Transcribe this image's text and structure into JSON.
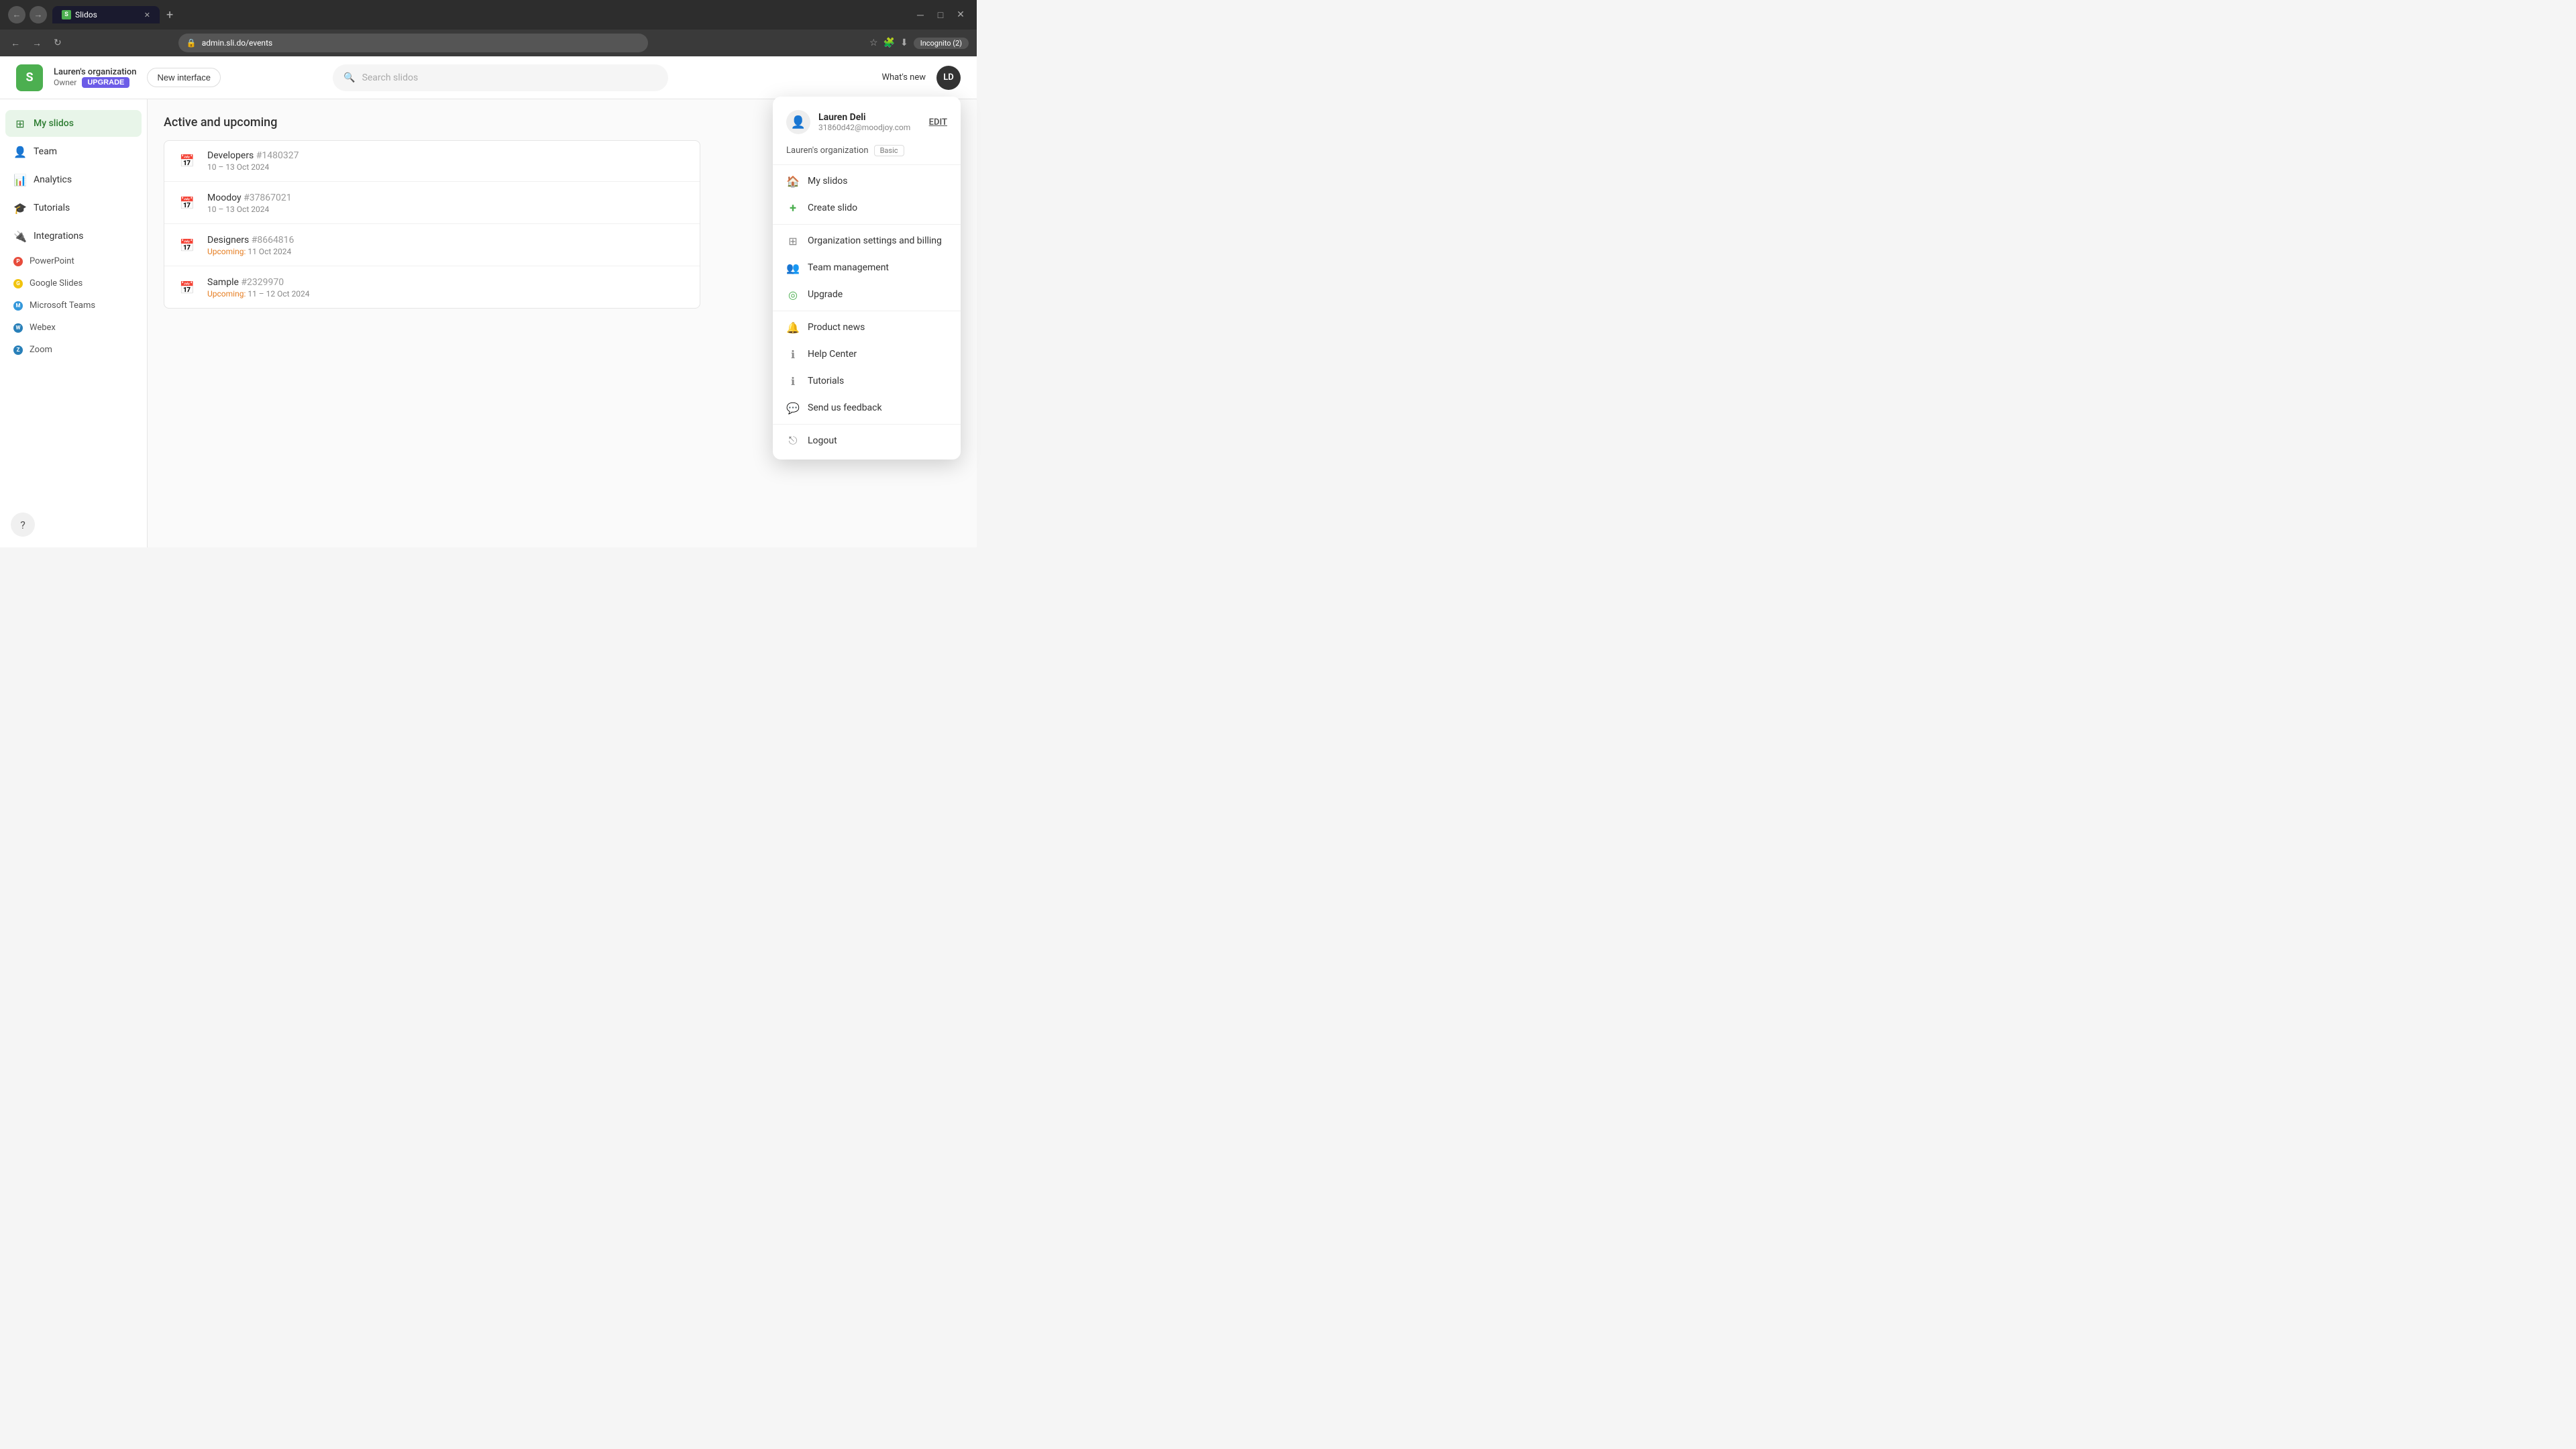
{
  "browser": {
    "tab_favicon": "S",
    "tab_title": "Slidos",
    "new_tab_icon": "+",
    "url": "admin.sli.do/events",
    "incognito_label": "Incognito (2)",
    "back_icon": "←",
    "forward_icon": "→",
    "refresh_icon": "↻"
  },
  "header": {
    "logo_letter": "S",
    "org_name": "Lauren's organization",
    "owner_label": "Owner",
    "upgrade_label": "UPGRADE",
    "new_interface_label": "New interface",
    "search_placeholder": "Search slidos",
    "whats_new_label": "What's new",
    "user_initials": "LD"
  },
  "sidebar": {
    "items": [
      {
        "id": "my-slidos",
        "label": "My slidos",
        "icon": "⊞",
        "active": true
      },
      {
        "id": "team",
        "label": "Team",
        "icon": "👤",
        "active": false
      },
      {
        "id": "analytics",
        "label": "Analytics",
        "icon": "📊",
        "active": false
      },
      {
        "id": "tutorials",
        "label": "Tutorials",
        "icon": "🎓",
        "active": false
      },
      {
        "id": "integrations",
        "label": "Integrations",
        "icon": "🔌",
        "active": false
      }
    ],
    "integrations": [
      {
        "id": "powerpoint",
        "label": "PowerPoint",
        "color": "#e74c3c"
      },
      {
        "id": "google-slides",
        "label": "Google Slides",
        "color": "#f1c40f"
      },
      {
        "id": "microsoft-teams",
        "label": "Microsoft Teams",
        "color": "#3498db"
      },
      {
        "id": "webex",
        "label": "Webex",
        "color": "#2980b9"
      },
      {
        "id": "zoom",
        "label": "Zoom",
        "color": "#2980b9"
      }
    ],
    "help_icon": "?"
  },
  "main": {
    "section_title": "Active and upcoming",
    "events": [
      {
        "name": "Developers",
        "id": "#1480327",
        "date": "10 – 13 Oct 2024",
        "upcoming": false
      },
      {
        "name": "Moodoy",
        "id": "#37867021",
        "date": "10 – 13 Oct 2024",
        "upcoming": false
      },
      {
        "name": "Designers",
        "id": "#8664816",
        "date": "11 Oct 2024",
        "upcoming": true
      },
      {
        "name": "Sample",
        "id": "#2329970",
        "date": "11 – 12 Oct 2024",
        "upcoming": true
      }
    ]
  },
  "dropdown": {
    "user_name": "Lauren Deli",
    "user_email": "31860d42@moodjoy.com",
    "edit_label": "EDIT",
    "org_name": "Lauren's organization",
    "org_plan": "Basic",
    "items": [
      {
        "id": "my-slidos",
        "label": "My slidos",
        "icon": "🏠",
        "icon_class": "icon-blue"
      },
      {
        "id": "create-slido",
        "label": "Create slido",
        "icon": "+",
        "icon_class": "icon-green"
      },
      {
        "id": "org-settings",
        "label": "Organization settings and billing",
        "icon": "⊞",
        "icon_class": "icon-gray"
      },
      {
        "id": "team-mgmt",
        "label": "Team management",
        "icon": "👥",
        "icon_class": "icon-gray"
      },
      {
        "id": "upgrade",
        "label": "Upgrade",
        "icon": "◎",
        "icon_class": "icon-green"
      },
      {
        "id": "product-news",
        "label": "Product news",
        "icon": "🔔",
        "icon_class": "icon-gray"
      },
      {
        "id": "help-center",
        "label": "Help Center",
        "icon": "ℹ",
        "icon_class": "icon-gray"
      },
      {
        "id": "tutorials",
        "label": "Tutorials",
        "icon": "ℹ",
        "icon_class": "icon-gray"
      },
      {
        "id": "feedback",
        "label": "Send us feedback",
        "icon": "💬",
        "icon_class": "icon-gray"
      },
      {
        "id": "logout",
        "label": "Logout",
        "icon": "⎋",
        "icon_class": "icon-gray"
      }
    ]
  }
}
